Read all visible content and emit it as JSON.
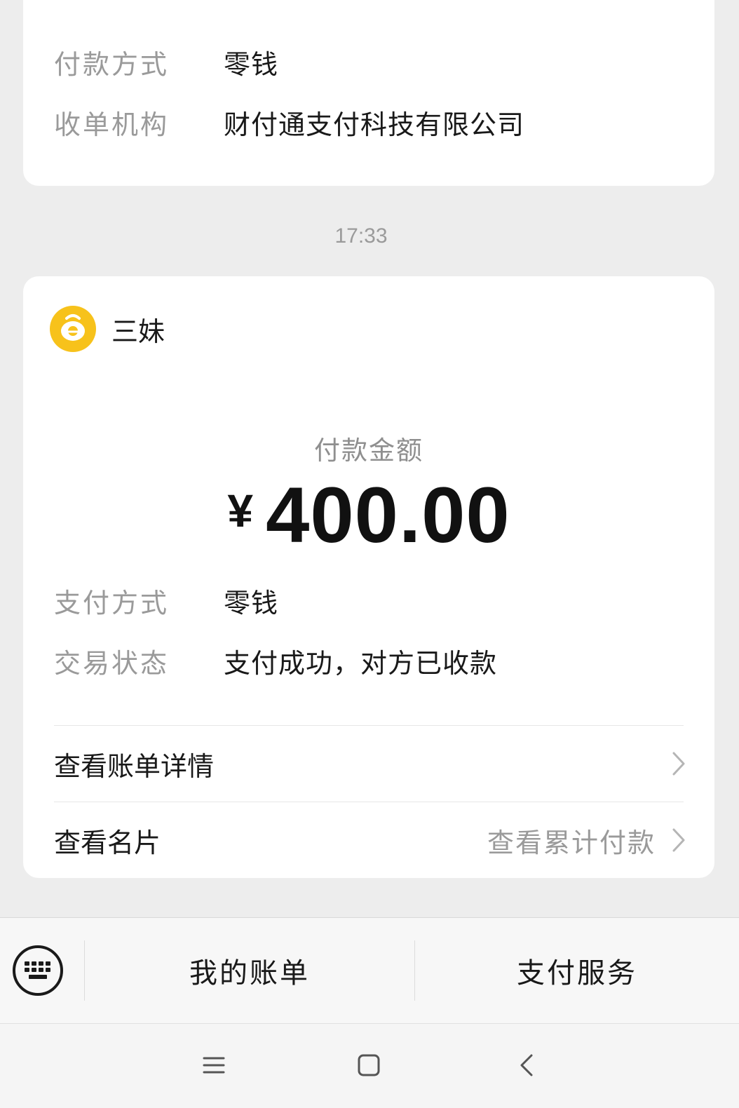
{
  "top_card": {
    "rows": [
      {
        "label": "付款方式",
        "value": "零钱"
      },
      {
        "label": "收单机构",
        "value": "财付通支付科技有限公司"
      }
    ]
  },
  "timestamp": "17:33",
  "main_card": {
    "merchant_name": "三妹",
    "amount_caption": "付款金额",
    "currency_symbol": "¥",
    "amount": "400.00",
    "rows": [
      {
        "label": "支付方式",
        "value": "零钱"
      },
      {
        "label": "交易状态",
        "value": "支付成功，对方已收款"
      }
    ],
    "links": [
      {
        "label": "查看账单详情",
        "extra": ""
      },
      {
        "label": "查看名片",
        "extra": "查看累计付款"
      }
    ]
  },
  "bottom_bar": {
    "left_menu": "我的账单",
    "right_menu": "支付服务"
  },
  "icons": {
    "keyboard": "keyboard-icon",
    "merchant_avatar": "merchant-avatar-icon",
    "chevron": "chevron-right-icon",
    "nav_menu": "menu-icon",
    "nav_home": "home-square-icon",
    "nav_back": "back-icon"
  },
  "colors": {
    "background": "#ededed",
    "card": "#ffffff",
    "avatar": "#f7c21b",
    "label_gray": "#9a9a9a"
  }
}
